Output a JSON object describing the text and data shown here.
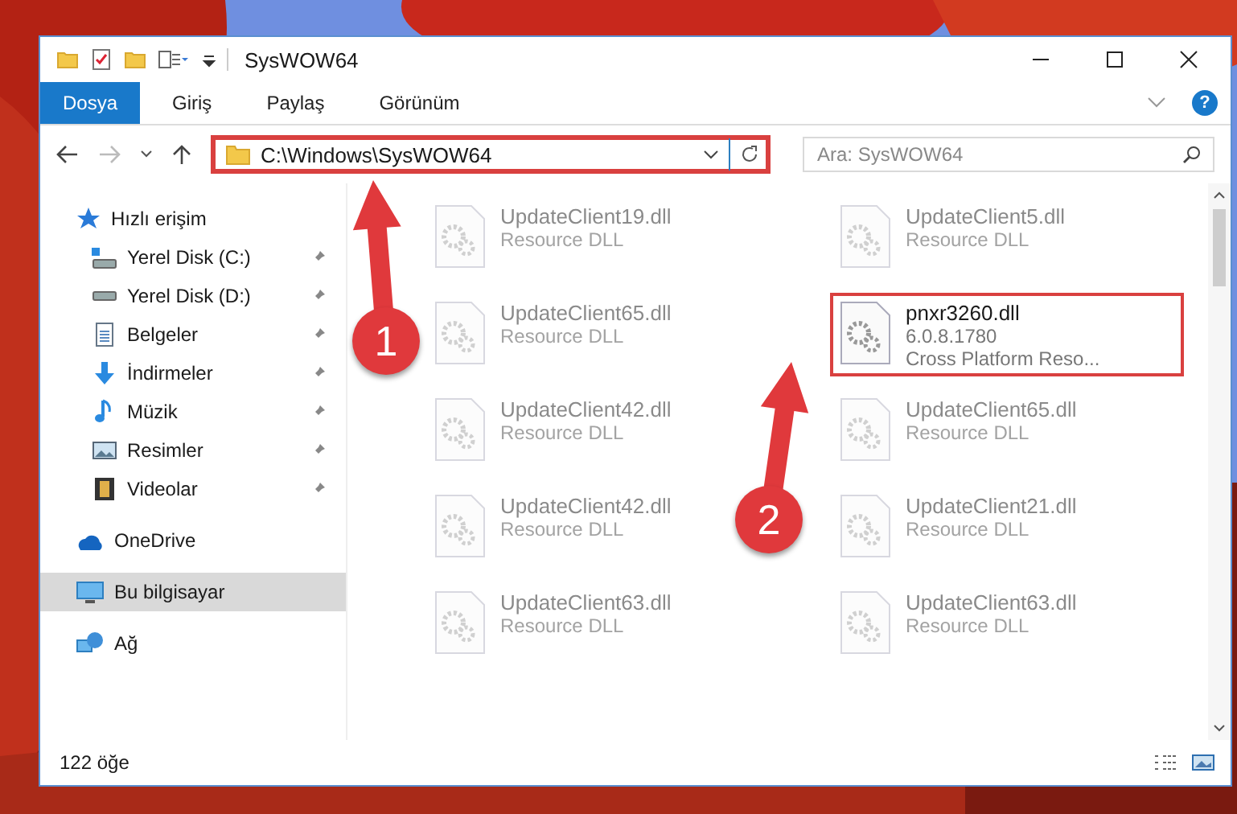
{
  "window": {
    "title": "SysWOW64"
  },
  "ribbon_tabs": [
    {
      "label": "Dosya",
      "selected": true
    },
    {
      "label": "Giriş",
      "selected": false
    },
    {
      "label": "Paylaş",
      "selected": false
    },
    {
      "label": "Görünüm",
      "selected": false
    }
  ],
  "help": "?",
  "address": {
    "value": "C:\\Windows\\SysWOW64",
    "highlighted": true
  },
  "search": {
    "placeholder": "Ara: SysWOW64"
  },
  "sidebar": {
    "items": [
      {
        "label": "Hızlı erişim",
        "kind": "star",
        "pinned": false,
        "selected": false,
        "children": [
          {
            "label": "Yerel Disk (C:)",
            "kind": "drive-c",
            "pinned": true,
            "selected": false
          },
          {
            "label": "Yerel Disk (D:)",
            "kind": "drive",
            "pinned": true,
            "selected": false
          },
          {
            "label": "Belgeler",
            "kind": "docs",
            "pinned": true,
            "selected": false
          },
          {
            "label": "İndirmeler",
            "kind": "download",
            "pinned": true,
            "selected": false
          },
          {
            "label": "Müzik",
            "kind": "music",
            "pinned": true,
            "selected": false
          },
          {
            "label": "Resimler",
            "kind": "pictures",
            "pinned": true,
            "selected": false
          },
          {
            "label": "Videolar",
            "kind": "video",
            "pinned": true,
            "selected": false
          }
        ]
      },
      {
        "label": "OneDrive",
        "kind": "cloud",
        "pinned": false,
        "selected": false
      },
      {
        "label": "Bu bilgisayar",
        "kind": "pc",
        "pinned": false,
        "selected": true
      },
      {
        "label": "Ağ",
        "kind": "network",
        "pinned": false,
        "selected": false
      }
    ]
  },
  "files": [
    {
      "name": "UpdateClient19.dll",
      "lines": [
        "Resource DLL"
      ],
      "faded": true,
      "highlighted": false
    },
    {
      "name": "UpdateClient5.dll",
      "lines": [
        "Resource DLL"
      ],
      "faded": true,
      "highlighted": false
    },
    {
      "name": "UpdateClient65.dll",
      "lines": [
        "Resource DLL"
      ],
      "faded": true,
      "highlighted": false
    },
    {
      "name": "pnxr3260.dll",
      "lines": [
        "6.0.8.1780",
        "Cross Platform Reso..."
      ],
      "faded": false,
      "highlighted": true
    },
    {
      "name": "UpdateClient42.dll",
      "lines": [
        "Resource DLL"
      ],
      "faded": true,
      "highlighted": false
    },
    {
      "name": "UpdateClient65.dll",
      "lines": [
        "Resource DLL"
      ],
      "faded": true,
      "highlighted": false
    },
    {
      "name": "UpdateClient42.dll",
      "lines": [
        "Resource DLL"
      ],
      "faded": true,
      "highlighted": false
    },
    {
      "name": "UpdateClient21.dll",
      "lines": [
        "Resource DLL"
      ],
      "faded": true,
      "highlighted": false
    },
    {
      "name": "UpdateClient63.dll",
      "lines": [
        "Resource DLL"
      ],
      "faded": true,
      "highlighted": false
    },
    {
      "name": "UpdateClient63.dll",
      "lines": [
        "Resource DLL"
      ],
      "faded": true,
      "highlighted": false
    }
  ],
  "status_bar": {
    "count": "122 öğe"
  },
  "annotations": [
    {
      "label": "1"
    },
    {
      "label": "2"
    }
  ]
}
